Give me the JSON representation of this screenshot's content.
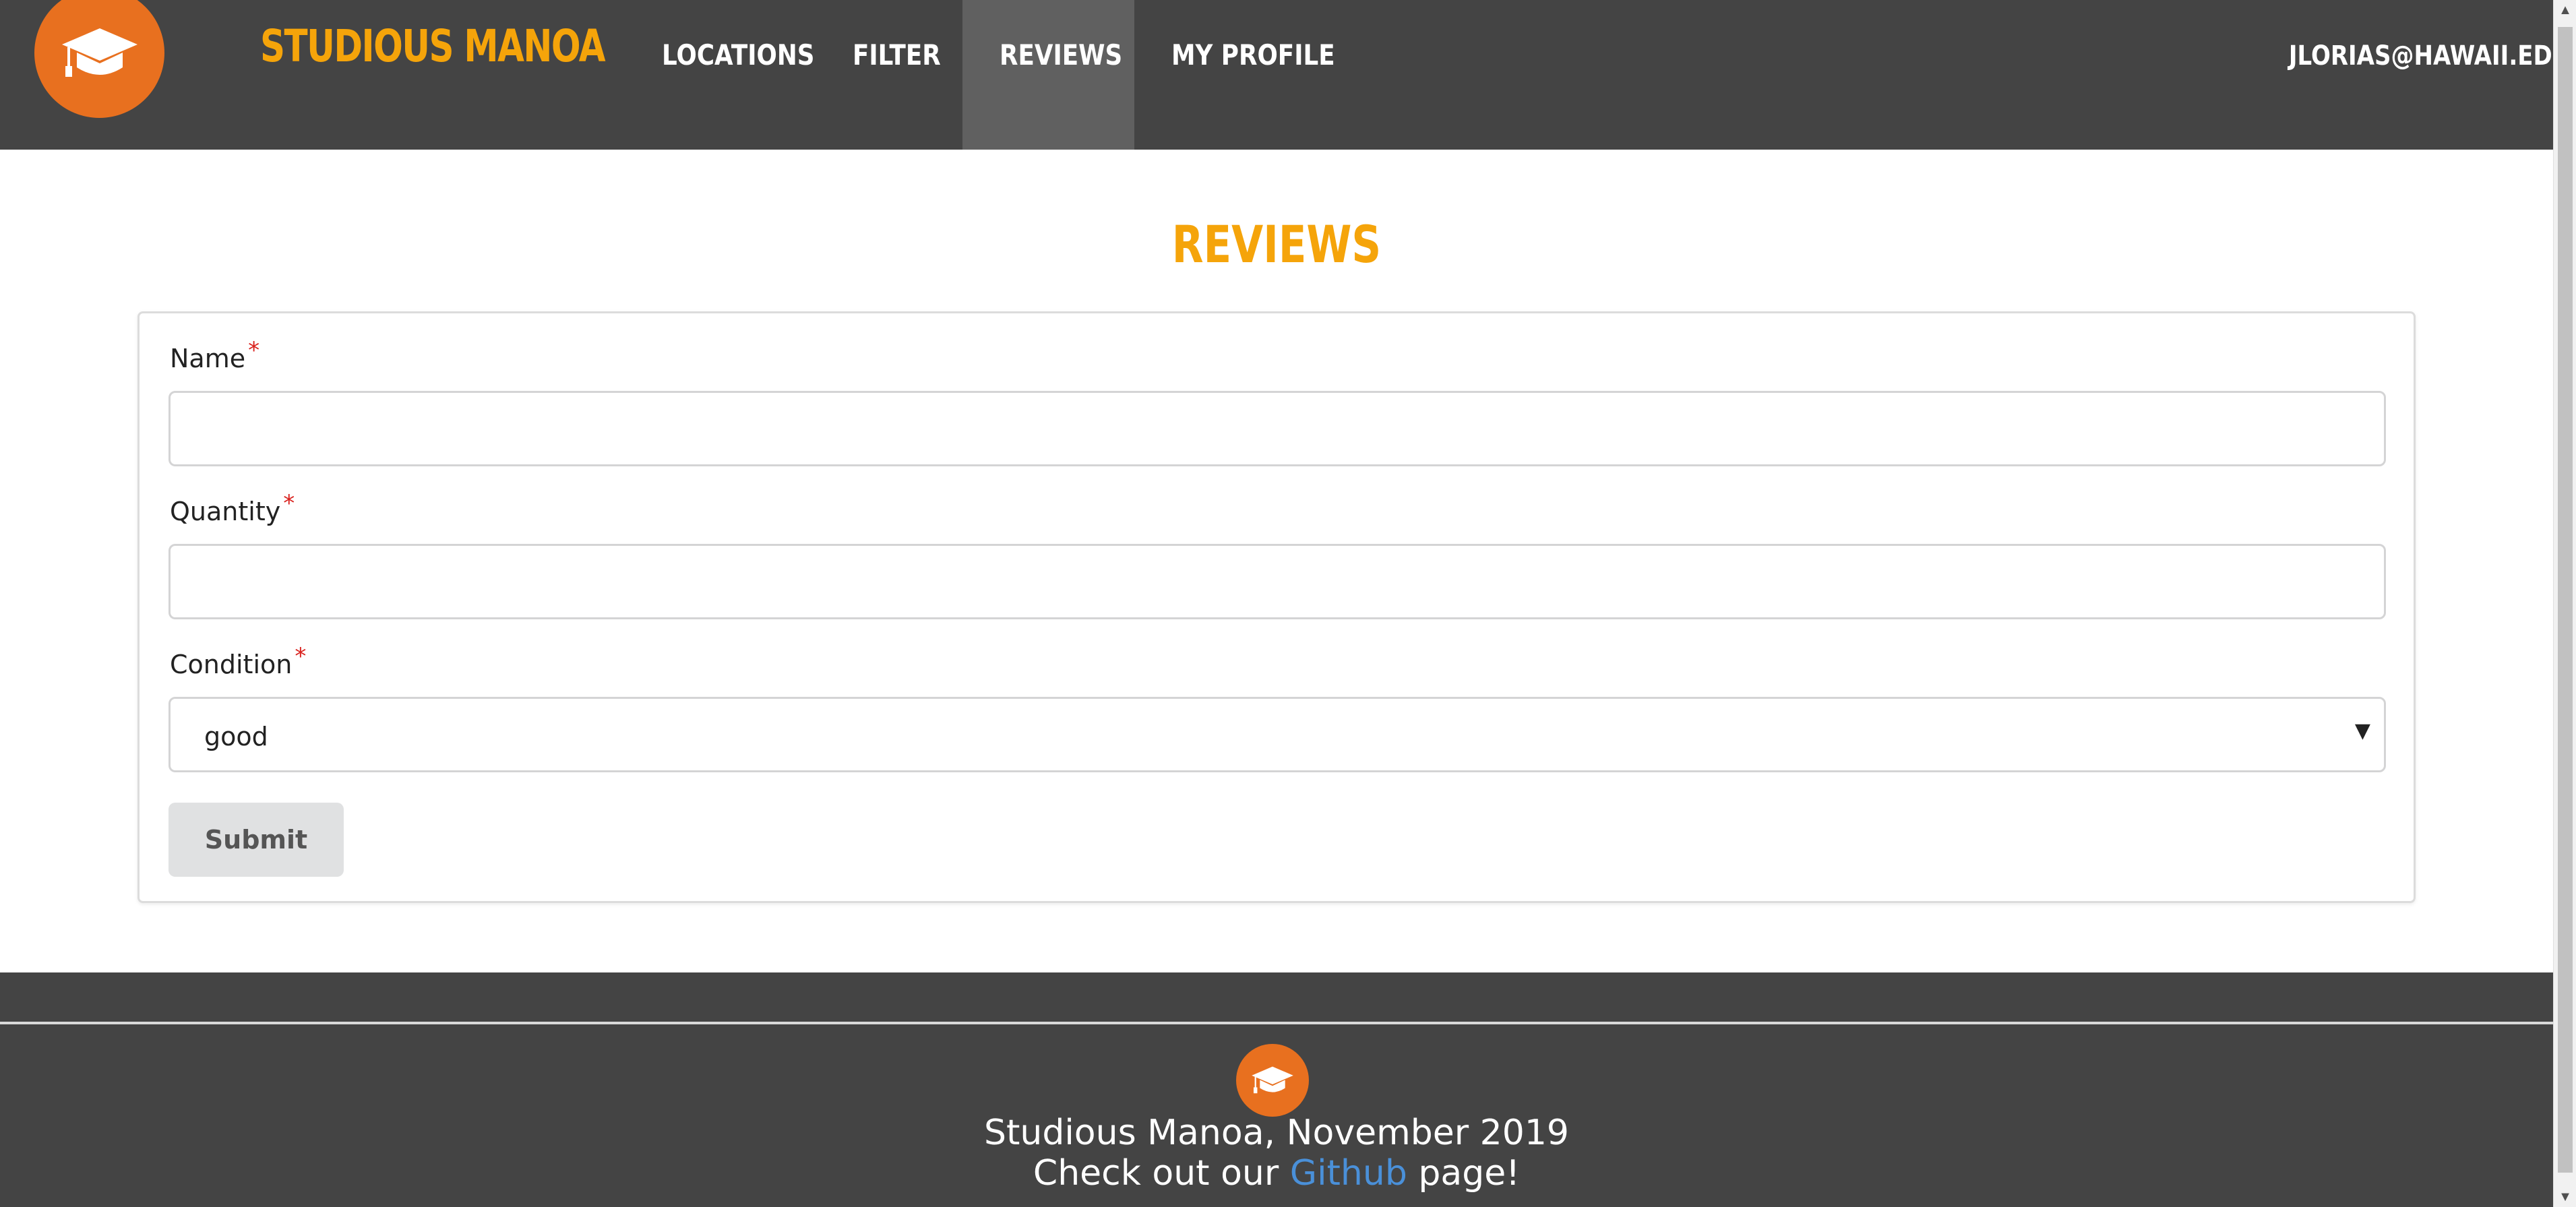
{
  "navbar": {
    "brand": "STUDIOUS MANOA",
    "logo_icon": "graduation-cap-icon",
    "items": [
      {
        "label": "LOCATIONS",
        "active": false
      },
      {
        "label": "FILTER",
        "active": false
      },
      {
        "label": "REVIEWS",
        "active": true
      },
      {
        "label": "MY PROFILE",
        "active": false
      }
    ],
    "user_email": "JLORIAS@HAWAII.EDU",
    "user_icon": "user-icon"
  },
  "main": {
    "title": "REVIEWS",
    "form": {
      "name_label": "Name",
      "name_value": "",
      "quantity_label": "Quantity",
      "quantity_value": "",
      "condition_label": "Condition",
      "condition_value": "good",
      "required_mark": "*",
      "submit_label": "Submit"
    }
  },
  "footer": {
    "line1": "Studious Manoa, November 2019",
    "line2_prefix": "Check out our",
    "link_text": "Github",
    "line2_suffix": "page!"
  },
  "colors": {
    "navbar_bg": "#444444",
    "brand": "#f5a40a",
    "logo_bg": "#e8701f",
    "active_tab": "#606060",
    "link": "#4a90d9",
    "required": "#d9231f"
  }
}
